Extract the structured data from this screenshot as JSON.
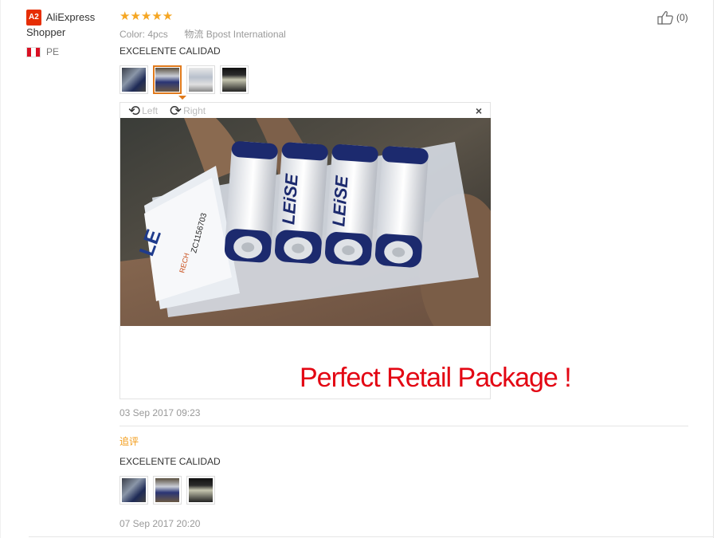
{
  "reviewer": {
    "level_badge": "A2",
    "name": "AliExpress Shopper",
    "country_code": "PE"
  },
  "review": {
    "stars": "★★★★★",
    "rating": 5,
    "color_label": "Color:",
    "color_value": "4pcs",
    "shipping_label": "物流",
    "shipping_value": "Bpost International",
    "text": "EXCELENTE CALIDAD",
    "date": "03 Sep 2017 09:23",
    "like_count": "(0)",
    "thumbnails": [
      "photo-1",
      "photo-2",
      "photo-3",
      "photo-4"
    ],
    "active_thumbnail": 2
  },
  "viewer": {
    "rotate_left": "Left",
    "rotate_right": "Right",
    "close": "×",
    "photo_labels": {
      "brand": "LEiSE",
      "package_brand": "LE",
      "barcode": "ZC1156703",
      "package_text": "RECH"
    }
  },
  "overlay_caption": "Perfect Retail Package !",
  "followup": {
    "label": "追评",
    "text": "EXCELENTE CALIDAD",
    "date": "07 Sep 2017 20:20",
    "thumbnails": [
      "photo-1",
      "photo-2",
      "photo-3"
    ]
  },
  "colors": {
    "accent": "#e07a1c",
    "star": "#f5a623",
    "followup": "#f29a14",
    "caption": "#e30613",
    "badge": "#e62e04"
  }
}
